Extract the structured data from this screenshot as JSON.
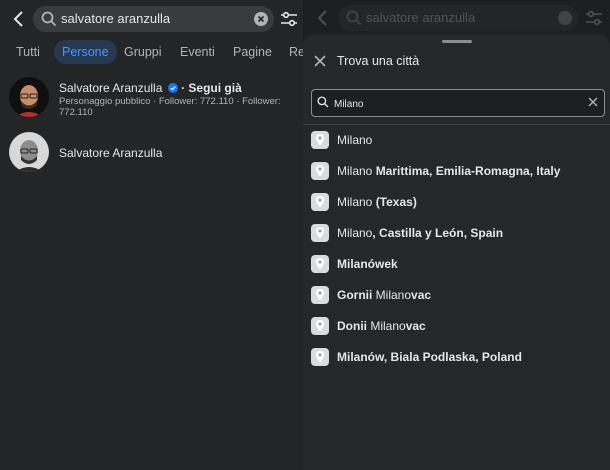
{
  "search": {
    "query": "salvatore aranzulla"
  },
  "tabs": [
    {
      "label": "Tutti"
    },
    {
      "label": "Persone"
    },
    {
      "label": "Gruppi"
    },
    {
      "label": "Eventi"
    },
    {
      "label": "Pagine"
    },
    {
      "label": "Re"
    }
  ],
  "results": [
    {
      "name": "Salvatore Aranzulla",
      "follow": "· Segui già",
      "meta": "Personaggio pubblico · Follower: 772.110 · Follower: 772.110"
    },
    {
      "name": "Salvatore Aranzulla"
    }
  ],
  "city_sheet": {
    "title": "Trova una città",
    "input_value": "Milano",
    "items": [
      {
        "normal": "Milano",
        "bold": ""
      },
      {
        "normal": "Milano ",
        "bold": "Marittima, Emilia-Romagna, Italy"
      },
      {
        "normal": "Milano ",
        "bold": "(Texas)"
      },
      {
        "normal": "Milano",
        "bold": ", Castilla y León, Spain"
      },
      {
        "bold_pre": "Milanówek"
      },
      {
        "bold_pre": "Gornii ",
        "normal": "Milano",
        "bold": "vac"
      },
      {
        "bold_pre": "Donii ",
        "normal": "Milano",
        "bold": "vac"
      },
      {
        "bold_pre": "Milanów, Biala Podlaska, Poland"
      }
    ]
  },
  "colors": {
    "accent": "#4599ff",
    "verified": "#1877f2"
  }
}
